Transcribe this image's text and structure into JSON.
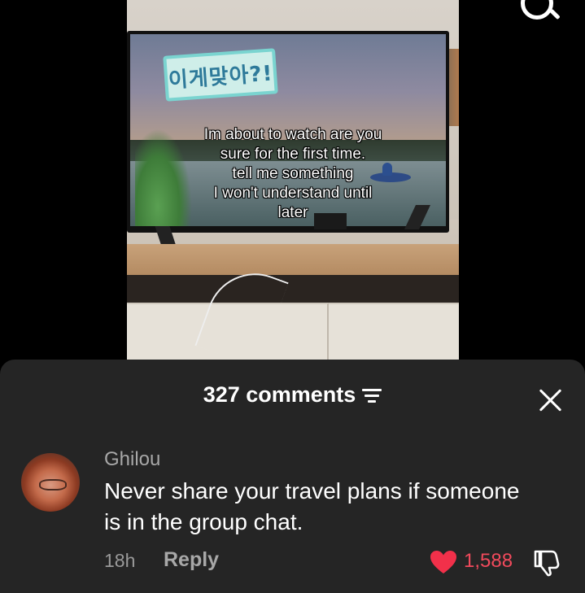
{
  "video": {
    "logo_text": "이게맞아?!",
    "caption_lines": [
      "Im about to watch are you",
      "sure for the first time.",
      "tell me something",
      "I won't understand until",
      "later"
    ]
  },
  "comments": {
    "header": "327 comments"
  },
  "comment": {
    "username": "Ghilou",
    "text": "Never share your travel plans if someone is in the group chat.",
    "time": "18h",
    "reply_label": "Reply",
    "like_count": "1,588",
    "like_color": "#f24a5c"
  },
  "icons": [
    "search-icon",
    "sort-icon",
    "close-icon",
    "heart-icon",
    "dislike-icon"
  ]
}
